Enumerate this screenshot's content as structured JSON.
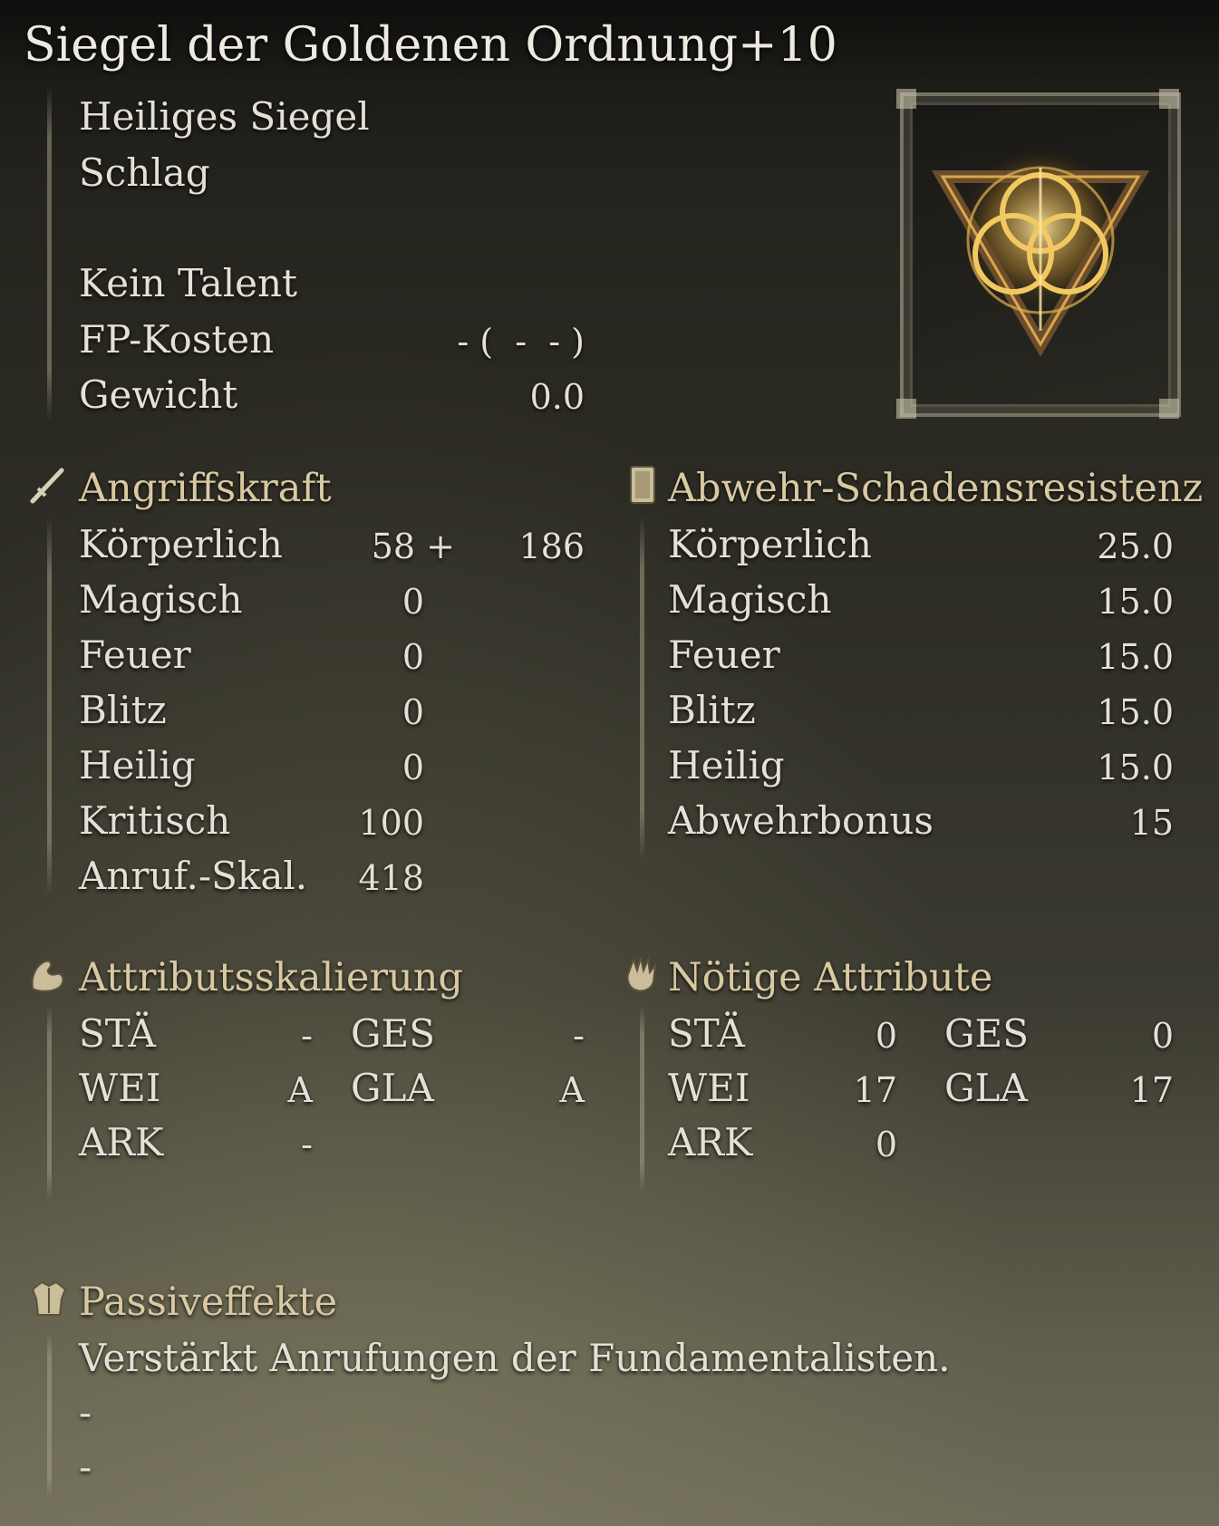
{
  "item": {
    "name": "Siegel der Goldenen Ordnung+10",
    "category": "Heiliges Siegel",
    "attack_type": "Schlag",
    "skill": "Kein Talent",
    "fp_label": "FP-Kosten",
    "fp_value": "- (  -  - )",
    "weight_label": "Gewicht",
    "weight_value": "0.0",
    "image_icon": "golden-order-seal-icon"
  },
  "attack": {
    "heading": "Angriffskraft",
    "icon": "sword-icon",
    "rows": [
      {
        "label": "Körperlich",
        "value": "58 +",
        "bonus": "186"
      },
      {
        "label": "Magisch",
        "value": "0"
      },
      {
        "label": "Feuer",
        "value": "0"
      },
      {
        "label": "Blitz",
        "value": "0"
      },
      {
        "label": "Heilig",
        "value": "0"
      },
      {
        "label": "Kritisch",
        "value": "100"
      },
      {
        "label": "Anruf.-Skal.",
        "value": "418"
      }
    ]
  },
  "guard": {
    "heading": "Abwehr-Schadensresistenz",
    "icon": "shield-icon",
    "rows": [
      {
        "label": "Körperlich",
        "value": "25.0"
      },
      {
        "label": "Magisch",
        "value": "15.0"
      },
      {
        "label": "Feuer",
        "value": "15.0"
      },
      {
        "label": "Blitz",
        "value": "15.0"
      },
      {
        "label": "Heilig",
        "value": "15.0"
      },
      {
        "label": "Abwehrbonus",
        "value": "15"
      }
    ]
  },
  "scaling": {
    "heading": "Attributsskalierung",
    "icon": "flexed-arm-icon",
    "rows": [
      {
        "a_label": "STÄ",
        "a_value": "-",
        "b_label": "GES",
        "b_value": "-"
      },
      {
        "a_label": "WEI",
        "a_value": "A",
        "b_label": "GLA",
        "b_value": "A"
      },
      {
        "a_label": "ARK",
        "a_value": "-"
      }
    ]
  },
  "requirements": {
    "heading": "Nötige Attribute",
    "icon": "open-hand-icon",
    "rows": [
      {
        "a_label": "STÄ",
        "a_value": "0",
        "b_label": "GES",
        "b_value": "0"
      },
      {
        "a_label": "WEI",
        "a_value": "17",
        "b_label": "GLA",
        "b_value": "17"
      },
      {
        "a_label": "ARK",
        "a_value": "0"
      }
    ]
  },
  "passive": {
    "heading": "Passiveffekte",
    "icon": "armor-chest-icon",
    "lines": [
      "Verstärkt Anrufungen der Fundamentalisten.",
      "-",
      "-"
    ]
  }
}
